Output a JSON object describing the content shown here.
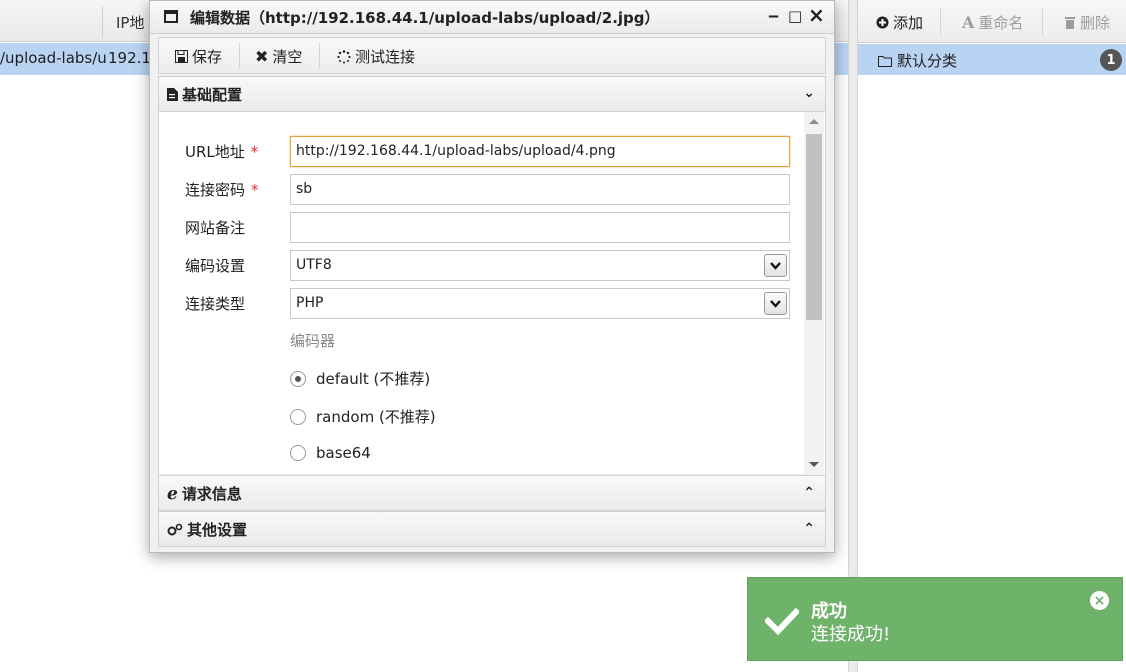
{
  "background_list": {
    "ip_header": "IP地",
    "row": {
      "url": "/upload-labs/u",
      "ip": "192.1"
    }
  },
  "category_panel": {
    "toolbar": {
      "add_label": "添加",
      "rename_label": "重命名",
      "delete_label": "删除"
    },
    "category": {
      "label": "默认分类",
      "count": "1"
    }
  },
  "modal": {
    "title": "编辑数据（http://192.168.44.1/upload-labs/upload/2.jpg）",
    "controls": {
      "minimize": "‒",
      "maximize": "□",
      "close": "×"
    },
    "toolbar": {
      "save_label": "保存",
      "clear_label": "清空",
      "test_label": "测试连接"
    },
    "sections": {
      "basic": "基础配置",
      "request": "请求信息",
      "other": "其他设置"
    },
    "form": {
      "url_label": "URL地址",
      "url_value": "http://192.168.44.1/upload-labs/upload/4.png",
      "password_label": "连接密码",
      "password_value": "sb",
      "note_label": "网站备注",
      "note_value": "",
      "encoding_label": "编码设置",
      "encoding_value": "UTF8",
      "type_label": "连接类型",
      "type_value": "PHP",
      "encoder_label": "编码器",
      "encoders": [
        {
          "label": "default (不推荐)",
          "selected": true
        },
        {
          "label": "random (不推荐)",
          "selected": false
        },
        {
          "label": "base64",
          "selected": false
        }
      ],
      "required_mark": "*"
    }
  },
  "toast": {
    "title": "成功",
    "message": "连接成功!"
  },
  "colors": {
    "toast_bg": "#6fb36a",
    "selection": "#b9d3f3",
    "focus_border": "#e0a23a",
    "required": "#d9302c"
  }
}
